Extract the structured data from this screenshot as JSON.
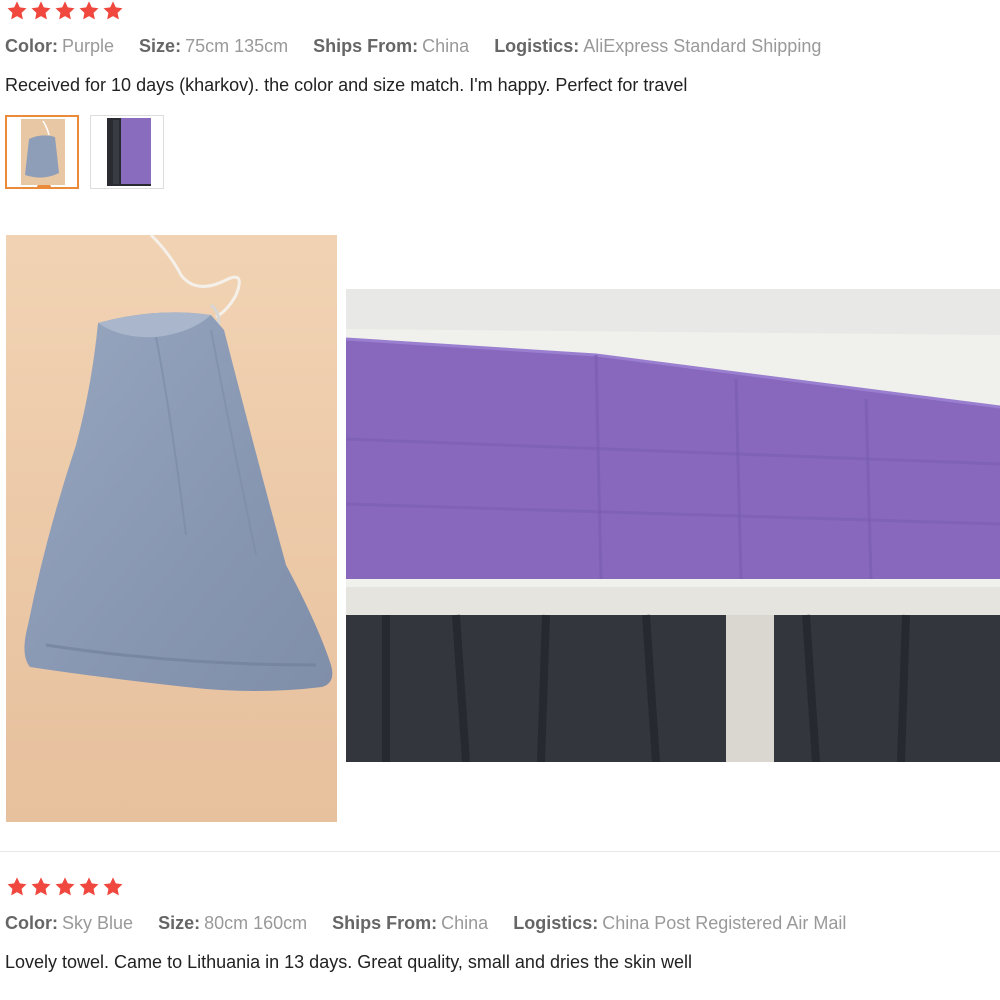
{
  "reviews": [
    {
      "rating": 5,
      "color_label": "Color:",
      "color_value": "Purple",
      "size_label": "Size:",
      "size_value": "75cm 135cm",
      "ships_label": "Ships From:",
      "ships_value": "China",
      "logistics_label": "Logistics:",
      "logistics_value": "AliExpress Standard Shipping",
      "text": "Received for 10 days (kharkov). the color and size match. I'm happy. Perfect for travel",
      "thumbnails": [
        {
          "icon": "blue-drawstring-bag-photo",
          "selected": true
        },
        {
          "icon": "purple-towel-photo",
          "selected": false
        }
      ],
      "photos": [
        {
          "icon": "blue-drawstring-bag-photo"
        },
        {
          "icon": "purple-towel-on-table-photo"
        }
      ]
    },
    {
      "rating": 5,
      "color_label": "Color:",
      "color_value": "Sky Blue",
      "size_label": "Size:",
      "size_value": "80cm 160cm",
      "ships_label": "Ships From:",
      "ships_value": "China",
      "logistics_label": "Logistics:",
      "logistics_value": "China Post Registered Air Mail",
      "text": "Lovely towel. Came to Lithuania in 13 days. Great quality, small and dries the skin well"
    }
  ],
  "colors": {
    "star": "#f0483e",
    "label": "#666666",
    "value": "#999999",
    "thumb_active_border": "#e98b3a",
    "towel": "#8a6cbf",
    "bag": "#8e9db8"
  }
}
